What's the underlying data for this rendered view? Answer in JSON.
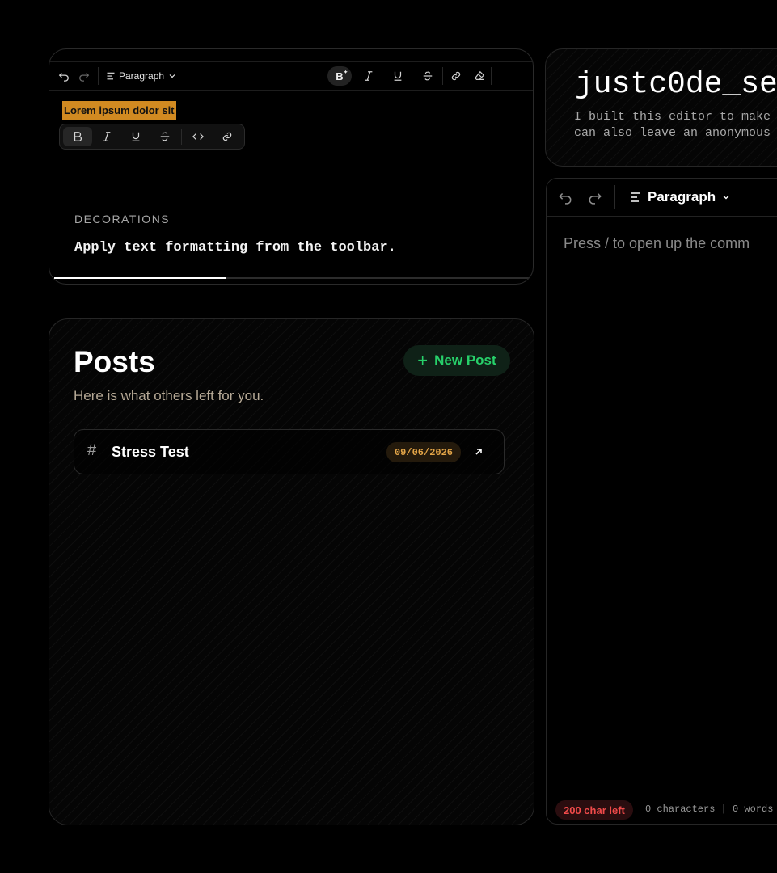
{
  "demo": {
    "toolbar": {
      "paragraph_label": "Paragraph"
    },
    "highlighted_text": "Lorem ipsum dolor sit",
    "caption_title": "DECORATIONS",
    "caption_text": "Apply text formatting from the toolbar.",
    "progress": 0.36
  },
  "posts": {
    "title": "Posts",
    "subtitle": "Here is what others left for you.",
    "new_post_label": "New Post",
    "items": [
      {
        "title": "Stress Test",
        "date": "09/06/2026"
      }
    ]
  },
  "header": {
    "title": "justc0de_se",
    "desc_line1": "I built this editor to make",
    "desc_line2": "can also leave an anonymous"
  },
  "editor": {
    "paragraph_label": "Paragraph",
    "placeholder": "Press / to open up the comm",
    "chars_left": "200 char left",
    "counts": "0 characters  |  0 words"
  },
  "colors": {
    "highlight": "#d18a21",
    "accent_green": "#27d06a",
    "date_badge": "#e3a548",
    "chars_left_red": "#f04a4a"
  }
}
